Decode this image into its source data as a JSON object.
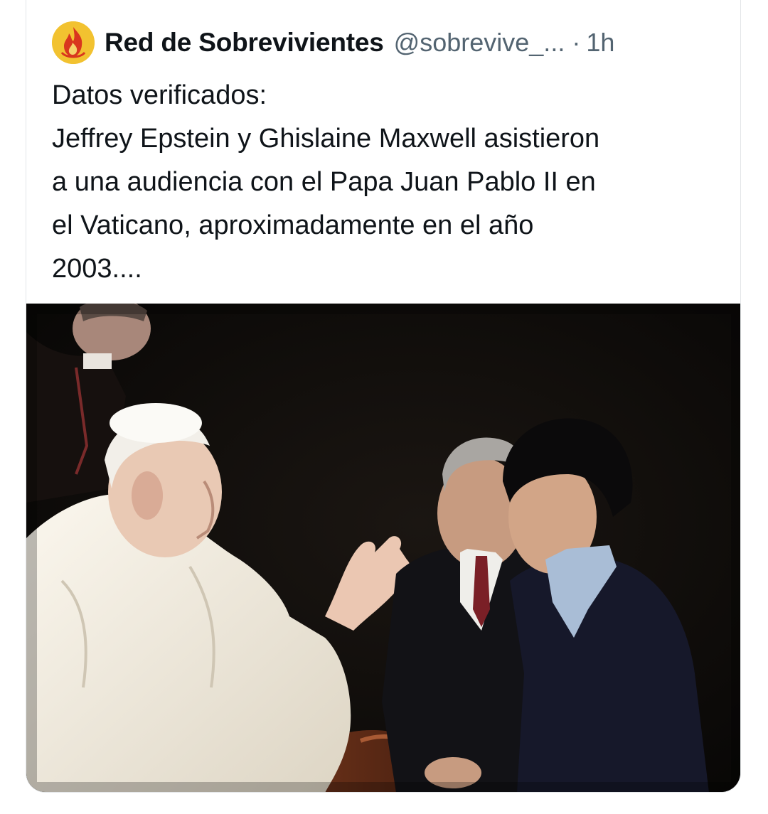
{
  "tweet": {
    "author_name": "Red de Sobrevivientes",
    "author_handle": "@sobrevive_...",
    "separator": "·",
    "time": "1h",
    "avatar_icon": "flame-logo-icon",
    "text_lines": [
      "Datos verificados:",
      "Jeffrey Epstein y Ghislaine Maxwell asistieron",
      "a una audiencia con el Papa Juan Pablo II en",
      "el Vaticano, aproximadamente en el año",
      "2003...."
    ]
  },
  "colors": {
    "text_primary": "#0f1419",
    "text_secondary": "#536471",
    "border": "#e3e6e8",
    "avatar_bg": "#f2c230",
    "flame": "#d9361e"
  }
}
